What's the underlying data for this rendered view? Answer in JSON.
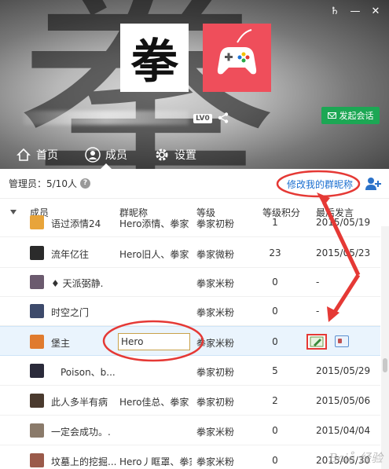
{
  "window": {
    "pin_glyph": "♄",
    "minimize_glyph": "—",
    "close_glyph": "✕"
  },
  "group": {
    "avatar_text": "拳",
    "level_badge": "LV0",
    "chat_button_label": "发起会话"
  },
  "tabs": [
    {
      "label": "首页",
      "icon": "home-icon",
      "active": false
    },
    {
      "label": "成员",
      "icon": "person-icon",
      "active": true
    },
    {
      "label": "设置",
      "icon": "gear-icon",
      "active": false
    }
  ],
  "admin_bar": {
    "admin_text": "管理员：5/10人",
    "help_glyph": "?",
    "edit_nickname_link": "修改我的群昵称"
  },
  "table": {
    "headers": [
      "成员",
      "群昵称",
      "等级",
      "等级积分",
      "最后发言"
    ],
    "rows": [
      {
        "name": "语过添情24",
        "nick": "Hero添情、拳家",
        "level": "拳家初粉",
        "points": "1",
        "date": "2015/05/19",
        "avatar_color": "#e8a43a"
      },
      {
        "name": "流年亿往",
        "nick": "Hero旧人、拳家",
        "level": "拳家微粉",
        "points": "23",
        "date": "2015/05/23",
        "avatar_color": "#2b2b2b"
      },
      {
        "name": "♦ 天派弼静.",
        "nick": "",
        "level": "拳家米粉",
        "points": "0",
        "date": "-",
        "avatar_color": "#6b5a6e"
      },
      {
        "name": "时空之门",
        "nick": "",
        "level": "拳家米粉",
        "points": "0",
        "date": "-",
        "avatar_color": "#3d4a6b"
      },
      {
        "name": "堡主",
        "nick": "",
        "nick_input_value": "Hero",
        "level": "拳家米粉",
        "points": "0",
        "date": "",
        "avatar_color": "#e07b2e",
        "editing": true
      },
      {
        "name": "Poison、b...",
        "nick": "",
        "level": "拳家初粉",
        "points": "5",
        "date": "2015/05/29",
        "avatar_color": "#2a2a3a"
      },
      {
        "name": "此人多半有病",
        "nick": "Hero佳总、拳家",
        "level": "拳家初粉",
        "points": "2",
        "date": "2015/05/06",
        "avatar_color": "#4a3a2e"
      },
      {
        "name": "一定会成功。.",
        "nick": "",
        "level": "拳家米粉",
        "points": "0",
        "date": "2015/04/04",
        "avatar_color": "#8a7a6a"
      },
      {
        "name": "坟墓上的挖掘...",
        "nick": "Hero丿眶罩、拳家",
        "level": "拳家米粉",
        "points": "0",
        "date": "2015/05/30",
        "avatar_color": "#9a5a4a"
      }
    ]
  },
  "annotation_color": "#e53935",
  "watermark": "Baiå 经验"
}
